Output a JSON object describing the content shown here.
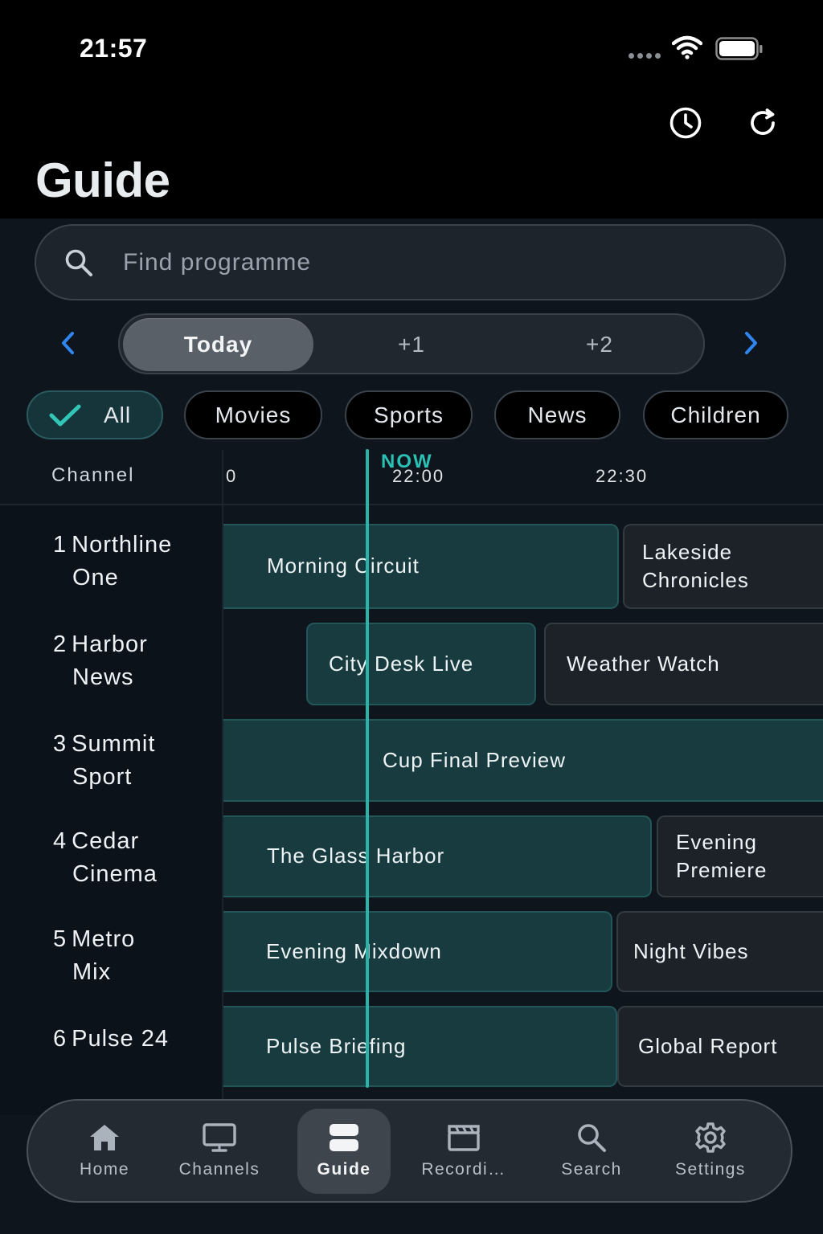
{
  "status_bar": {
    "time": "21:57"
  },
  "header": {
    "title": "Guide",
    "icons": [
      "clock-icon",
      "refresh-icon"
    ]
  },
  "search": {
    "placeholder": "Find programme",
    "value": ""
  },
  "day_selector": {
    "options": [
      "Today",
      "+1",
      "+2"
    ],
    "selected": "Today"
  },
  "filters": {
    "chips": [
      "All",
      "Movies",
      "Sports",
      "News",
      "Children"
    ],
    "selected": "All"
  },
  "timeline": {
    "channel_header": "Channel",
    "ticks": [
      "0",
      "22:00",
      "22:30"
    ],
    "now_label": "NOW"
  },
  "channels": [
    {
      "number": "1",
      "name_line1": "Northline",
      "name_line2": "One",
      "programmes": [
        {
          "title": "Morning Circuit"
        },
        {
          "title_line1": "Lakeside",
          "title_line2": "Chronicles"
        }
      ]
    },
    {
      "number": "2",
      "name_line1": "Harbor",
      "name_line2": "News",
      "programmes": [
        {
          "title": "City Desk Live"
        },
        {
          "title": "Weather Watch"
        }
      ]
    },
    {
      "number": "3",
      "name_line1": "Summit",
      "name_line2": "Sport",
      "programmes": [
        {
          "title": "Cup Final Preview"
        }
      ]
    },
    {
      "number": "4",
      "name_line1": "Cedar",
      "name_line2": "Cinema",
      "programmes": [
        {
          "title": "The Glass Harbor"
        },
        {
          "title_line1": "Evening",
          "title_line2": "Premiere"
        }
      ]
    },
    {
      "number": "5",
      "name_line1": "Metro",
      "name_line2": "Mix",
      "programmes": [
        {
          "title": "Evening Mixdown"
        },
        {
          "title": "Night Vibes"
        }
      ]
    },
    {
      "number": "6",
      "name_line1": "Pulse 24",
      "programmes": [
        {
          "title": "Pulse Briefing"
        },
        {
          "title": "Global Report"
        }
      ]
    }
  ],
  "tabbar": {
    "items": [
      {
        "label": "Home",
        "icon": "home-icon"
      },
      {
        "label": "Channels",
        "icon": "tv-icon"
      },
      {
        "label": "Guide",
        "icon": "guide-icon"
      },
      {
        "label": "Recordi…",
        "icon": "clapperboard-icon"
      },
      {
        "label": "Search",
        "icon": "search-icon"
      },
      {
        "label": "Settings",
        "icon": "gear-icon"
      }
    ],
    "selected": "Guide"
  },
  "colors": {
    "accent_teal": "#2ab3a8",
    "programme_teal": "#173b3e",
    "arrow_blue": "#2f86f0",
    "check_teal": "#32c6b6"
  }
}
